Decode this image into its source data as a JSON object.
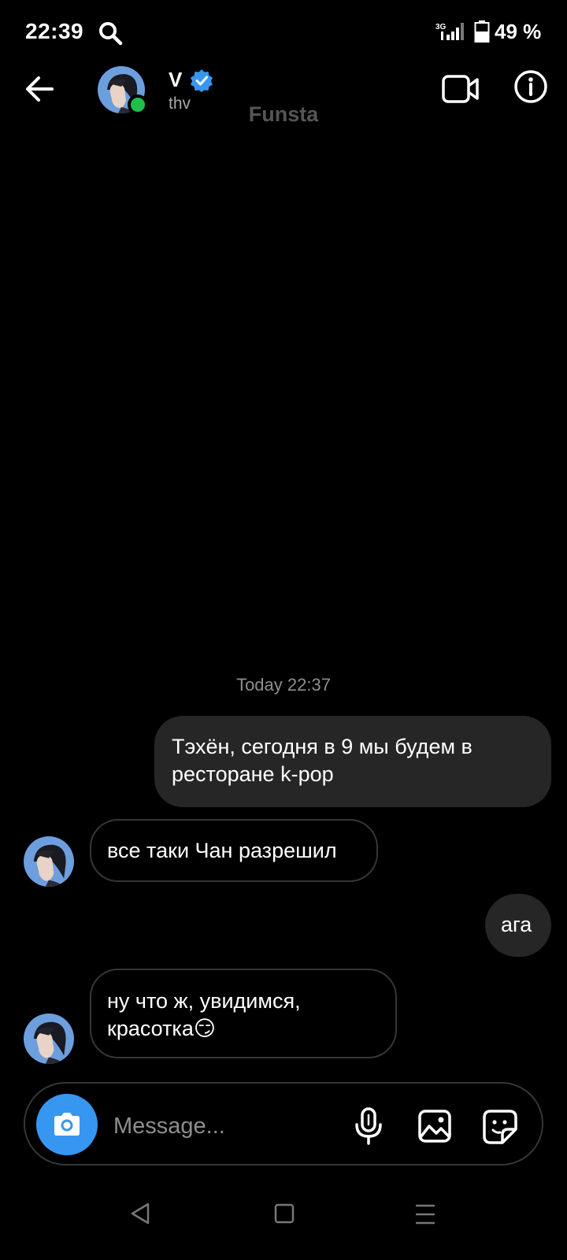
{
  "status_bar": {
    "time": "22:39",
    "network": "3G",
    "battery": "49 %",
    "icons": [
      "search-icon",
      "signal-icon",
      "battery-icon"
    ]
  },
  "header": {
    "name": "V",
    "handle": "thv",
    "watermark": "Funsta",
    "online": true,
    "icons": [
      "back-arrow-icon",
      "verified-badge-icon",
      "video-call-icon",
      "info-icon"
    ]
  },
  "chat": {
    "timestamp": "Today 22:37",
    "messages": [
      {
        "direction": "outgoing",
        "text": "Тэхён, сегодня в 9 мы будем в ресторане k-pop"
      },
      {
        "direction": "incoming",
        "text": "все таки Чан разрешил"
      },
      {
        "direction": "outgoing",
        "text": "ага"
      },
      {
        "direction": "incoming",
        "text": "ну что ж, увидимся, красотка😏"
      }
    ]
  },
  "composer": {
    "placeholder": "Message...",
    "icons": [
      "camera-icon",
      "microphone-icon",
      "gallery-icon",
      "sticker-icon"
    ]
  },
  "nav_bar": {
    "icons": [
      "nav-back-icon",
      "nav-home-icon",
      "nav-menu-icon"
    ]
  },
  "colors": {
    "background": "#000000",
    "outgoing_bubble": "#262626",
    "incoming_border": "#363636",
    "accent_blue": "#3797f0",
    "online_green": "#1fbf4a",
    "muted_text": "#8e8e8e"
  }
}
